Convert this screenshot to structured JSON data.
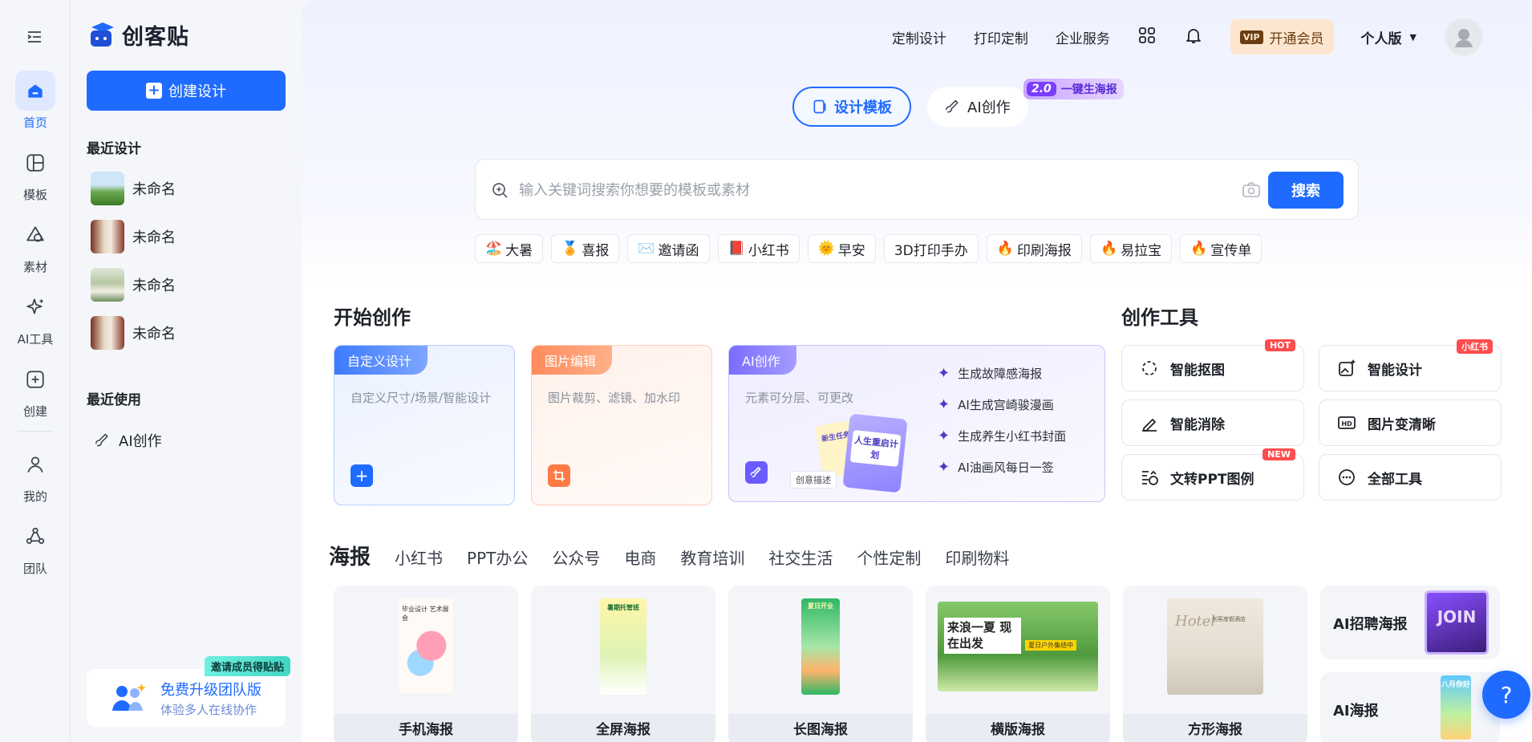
{
  "rail": {
    "items": [
      {
        "label": "首页"
      },
      {
        "label": "模板"
      },
      {
        "label": "素材"
      },
      {
        "label": "AI工具"
      },
      {
        "label": "创建"
      },
      {
        "label": "我的"
      },
      {
        "label": "团队"
      }
    ]
  },
  "sidebar": {
    "logo_text": "创客贴",
    "create_label": "创建设计",
    "recent_title": "最近设计",
    "recent_items": [
      {
        "label": "未命名"
      },
      {
        "label": "未命名"
      },
      {
        "label": "未命名"
      },
      {
        "label": "未命名"
      }
    ],
    "used_title": "最近使用",
    "used_item": "AI创作",
    "invite": {
      "badge": "邀请成员得贴贴",
      "title": "免费升级团队版",
      "subtitle": "体验多人在线协作"
    }
  },
  "topnav": {
    "links": [
      "定制设计",
      "打印定制",
      "企业服务"
    ],
    "vip_label": "开通会员",
    "vip_icon": "VIP",
    "personal": "个人版"
  },
  "modes": {
    "tabs": [
      {
        "label": "设计模板"
      },
      {
        "label": "AI创作"
      }
    ],
    "badge_version": "2.0",
    "badge_text": "一键生海报"
  },
  "search": {
    "placeholder": "输入关键词搜索你想要的模板或素材",
    "button": "搜索"
  },
  "hot_tags": [
    {
      "icon": "🏖️",
      "label": "大暑"
    },
    {
      "icon": "🏅",
      "label": "喜报"
    },
    {
      "icon": "✉️",
      "label": "邀请函"
    },
    {
      "icon": "📕",
      "label": "小红书"
    },
    {
      "icon": "🌞",
      "label": "早安"
    },
    {
      "icon": "",
      "label": "3D打印手办"
    },
    {
      "icon": "🔥",
      "label": "印刷海报"
    },
    {
      "icon": "🔥",
      "label": "易拉宝"
    },
    {
      "icon": "🔥",
      "label": "宣传单"
    }
  ],
  "start": {
    "title": "开始创作",
    "cards": [
      {
        "tag": "自定义设计",
        "desc": "自定义尺寸/场景/智能设计"
      },
      {
        "tag": "图片编辑",
        "desc": "图片裁剪、滤镜、加水印"
      },
      {
        "tag": "AI创作",
        "desc": "元素可分层、可更改",
        "input_hint": "创意描述",
        "poster_text": "人生重启计划",
        "poster_sub": "新生任务",
        "items": [
          "生成故障感海报",
          "AI生成宫崎骏漫画",
          "生成养生小红书封面",
          "AI油画风每日一签"
        ]
      }
    ]
  },
  "tools": {
    "title": "创作工具",
    "items": [
      {
        "label": "智能抠图",
        "badge": "HOT"
      },
      {
        "label": "智能设计",
        "badge": "小红书"
      },
      {
        "label": "智能消除",
        "badge": ""
      },
      {
        "label": "图片变清晰",
        "badge": ""
      },
      {
        "label": "文转PPT图例",
        "badge": "NEW"
      },
      {
        "label": "全部工具",
        "badge": ""
      }
    ]
  },
  "categories": {
    "tabs": [
      "海报",
      "小红书",
      "PPT办公",
      "公众号",
      "电商",
      "教育培训",
      "社交生活",
      "个性定制",
      "印刷物料"
    ]
  },
  "templates": [
    {
      "label": "手机海报",
      "art_text": "毕业设计 艺术展会"
    },
    {
      "label": "全屏海报",
      "art_text": "暑期托管班"
    },
    {
      "label": "长图海报",
      "art_text": "夏日开业"
    },
    {
      "label": "横版海报",
      "art_text": "来浪一夏 现在出发",
      "art_sub": "夏日户外集结中"
    },
    {
      "label": "方形海报",
      "art_text": "Hotel",
      "art_sub": "创客度假酒店"
    }
  ],
  "side_templates": [
    {
      "label": "AI招聘海报",
      "art_text": "JOIN"
    },
    {
      "label": "AI海报",
      "art_text": "八月你好"
    }
  ],
  "help": "?"
}
